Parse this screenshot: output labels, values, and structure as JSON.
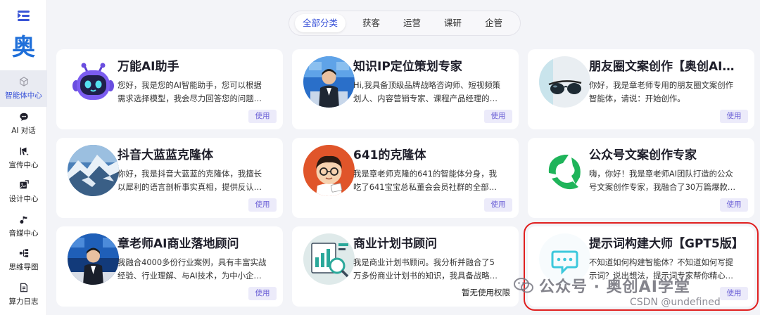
{
  "sidebar": {
    "logo_text": "奥",
    "items": [
      {
        "label": "智能体中心",
        "icon": "cube-icon",
        "active": true
      },
      {
        "label": "AI 对话",
        "icon": "chat-bubble-icon"
      },
      {
        "label": "宣传中心",
        "icon": "megaphone-icon"
      },
      {
        "label": "设计中心",
        "icon": "image-edit-icon"
      },
      {
        "label": "音媒中心",
        "icon": "music-note-icon"
      },
      {
        "label": "思维导图",
        "icon": "mind-map-icon"
      },
      {
        "label": "算力日志",
        "icon": "log-document-icon"
      }
    ]
  },
  "tabs": [
    "全部分类",
    "获客",
    "运营",
    "课研",
    "企管"
  ],
  "active_tab": "全部分类",
  "cards": [
    {
      "title": "万能AI助手",
      "desc": [
        "您好，我是您的AI智能助手，您可以根据",
        "需求选择模型，我会尽力回答您的问题…"
      ],
      "action": "使用",
      "avatar": "robot-avatar"
    },
    {
      "title": "知识IP定位策划专家",
      "desc": [
        "Hi,我具备顶级品牌战略咨询师、短视频策",
        "划人、内容营销专家、课程产品经理的…"
      ],
      "action": "使用",
      "avatar": "presenter-avatar"
    },
    {
      "title": "朋友圈文案创作【奥创AI…",
      "desc": [
        "你好，我是章老师专用的朋友圈文案创作",
        "智能体，请说：开始创作。"
      ],
      "action": "使用",
      "avatar": "sunglasses-avatar"
    },
    {
      "title": "抖音大蓝蓝克隆体",
      "desc": [
        "你好，我是抖音大蓝蓝的克隆体，我擅长",
        "以犀利的语言剖析事实真相，提供反认…"
      ],
      "action": "使用",
      "avatar": "snow-mountain-avatar"
    },
    {
      "title": "641的克隆体",
      "desc": [
        "我是章老师克隆的641的智能体分身，我",
        "吃了641宝宝总私董会会员社群的全部…"
      ],
      "action": "使用",
      "avatar": "cartoon-boy-avatar"
    },
    {
      "title": "公众号文案创作专家",
      "desc": [
        "嗨，你好！我是章老师AI团队打造的公众",
        "号文案创作专家，我融合了30万篇爆款…"
      ],
      "action": "使用",
      "avatar": "green-logo-avatar"
    },
    {
      "title": "章老师AI商业落地顾问",
      "desc": [
        "我融合4000多份行业案例，具有丰富实战",
        "经验、行业理解、与AI技术，为中小企…"
      ],
      "action": "使用",
      "avatar": "speaker-avatar"
    },
    {
      "title": "商业计划书顾问",
      "desc": [
        "我是商业计划书顾问。我分析并融合了5",
        "万多份商业计划书的知识，我具备战略…"
      ],
      "action": "暂无使用权限",
      "avatar": "business-plan-avatar"
    },
    {
      "title": "提示词构建大师【GPT5版】",
      "desc": [
        "不知道如何构建智能体？不知道如何写提",
        "示词？说出想法，提示词专家帮你精心…"
      ],
      "action": "使用",
      "avatar": "chat-icon-avatar"
    }
  ],
  "watermarks": {
    "wechat": "公众号 · 奥创AI学堂",
    "csdn": "CSDN @undefined"
  },
  "colors": {
    "accent": "#3650d8",
    "highlight_border": "#e02020",
    "use_button_bg": "#ecebfa"
  }
}
